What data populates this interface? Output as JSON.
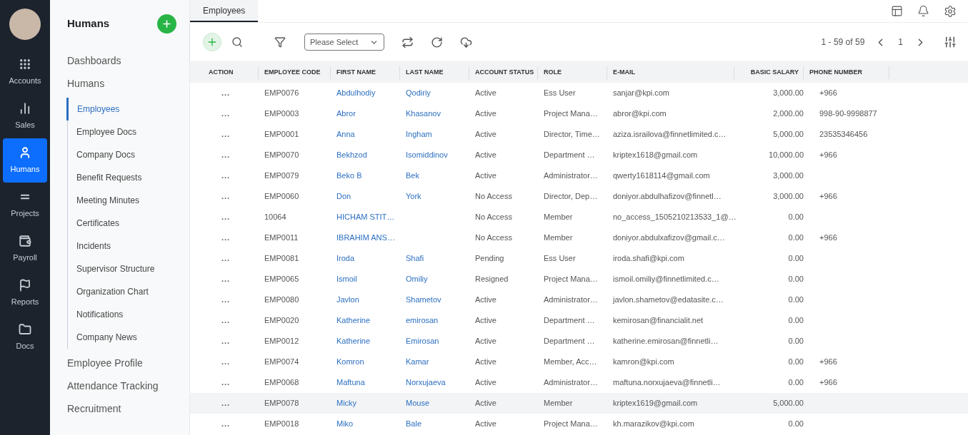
{
  "rail": {
    "items": [
      {
        "label": "Accounts",
        "selected": false
      },
      {
        "label": "Sales",
        "selected": false
      },
      {
        "label": "Humans",
        "selected": true
      },
      {
        "label": "Projects",
        "selected": false
      },
      {
        "label": "Payroll",
        "selected": false
      },
      {
        "label": "Reports",
        "selected": false
      },
      {
        "label": "Docs",
        "selected": false
      }
    ]
  },
  "nav": {
    "title": "Humans",
    "sections": [
      {
        "label": "Dashboards"
      },
      {
        "label": "Humans",
        "children": [
          {
            "label": "Employees",
            "selected": true
          },
          {
            "label": "Employee Docs",
            "selected": false
          },
          {
            "label": "Company Docs",
            "selected": false
          },
          {
            "label": "Benefit Requests",
            "selected": false
          },
          {
            "label": "Meeting Minutes",
            "selected": false
          },
          {
            "label": "Certificates",
            "selected": false
          },
          {
            "label": "Incidents",
            "selected": false
          },
          {
            "label": "Supervisor Structure",
            "selected": false
          },
          {
            "label": "Organization Chart",
            "selected": false
          },
          {
            "label": "Notifications",
            "selected": false
          },
          {
            "label": "Company News",
            "selected": false
          }
        ]
      },
      {
        "label": "Employee Profile"
      },
      {
        "label": "Attendance Tracking"
      },
      {
        "label": "Recruitment"
      }
    ]
  },
  "tabs": [
    {
      "label": "Employees",
      "selected": true
    }
  ],
  "toolbar": {
    "select": {
      "placeholder": "Please Select"
    },
    "pagination": {
      "range": "1 - 59 of 59",
      "page": "1"
    }
  },
  "table": {
    "columns": [
      "ACTION",
      "EMPLOYEE CODE",
      "FIRST NAME",
      "LAST NAME",
      "ACCOUNT STATUS",
      "ROLE",
      "E-MAIL",
      "BASIC SALARY",
      "PHONE NUMBER"
    ],
    "rows": [
      {
        "action": "...",
        "code": "EMP0076",
        "first": "Abdulhodiy",
        "last": "Qodiriy",
        "status": "Active",
        "role": "Ess User",
        "email": "sanjar@kpi.com",
        "salary": "3,000.00",
        "phone": "+966",
        "highlighted": false
      },
      {
        "action": "...",
        "code": "EMP0003",
        "first": "Abror",
        "last": "Khasanov",
        "status": "Active",
        "role": "Project Mana…",
        "email": "abror@kpi.com",
        "salary": "2,000.00",
        "phone": "998-90-9998877",
        "highlighted": false
      },
      {
        "action": "...",
        "code": "EMP0001",
        "first": "Anna",
        "last": "Ingham",
        "status": "Active",
        "role": "Director, Time…",
        "email": "aziza.israilova@finnetlimited.c…",
        "salary": "5,000.00",
        "phone": "23535346456",
        "highlighted": false
      },
      {
        "action": "...",
        "code": "EMP0070",
        "first": "Bekhzod",
        "last": "Isomiddinov",
        "status": "Active",
        "role": "Department …",
        "email": "kriptex1618@gmail.com",
        "salary": "10,000.00",
        "phone": "+966",
        "highlighted": false
      },
      {
        "action": "...",
        "code": "EMP0079",
        "first": "Beko B",
        "last": "Bek",
        "status": "Active",
        "role": "Administrator…",
        "email": "qwerty1618114@gmail.com",
        "salary": "3,000.00",
        "phone": "",
        "highlighted": false
      },
      {
        "action": "...",
        "code": "EMP0060",
        "first": "Don",
        "last": "York",
        "status": "No Access",
        "role": "Director, Dep…",
        "email": "doniyor.abdulhafizov@finnetl…",
        "salary": "3,000.00",
        "phone": "+966",
        "highlighted": false
      },
      {
        "action": "...",
        "code": "10064",
        "first": "HICHAM STIT…",
        "last": "",
        "status": "No Access",
        "role": "Member",
        "email": "no_access_1505210213533_1@…",
        "salary": "0.00",
        "phone": "",
        "highlighted": false
      },
      {
        "action": "...",
        "code": "EMP0011",
        "first": "IBRAHIM ANS…",
        "last": "",
        "status": "No Access",
        "role": "Member",
        "email": "doniyor.abdulxafizov@gmail.c…",
        "salary": "0.00",
        "phone": "+966",
        "highlighted": false
      },
      {
        "action": "...",
        "code": "EMP0081",
        "first": "Iroda",
        "last": "Shafi",
        "status": "Pending",
        "role": "Ess User",
        "email": "iroda.shafi@kpi.com",
        "salary": "0.00",
        "phone": "",
        "highlighted": false
      },
      {
        "action": "...",
        "code": "EMP0065",
        "first": "Ismoil",
        "last": "Omiliy",
        "status": "Resigned",
        "role": "Project Mana…",
        "email": "ismoil.omiliy@finnetlimited.c…",
        "salary": "0.00",
        "phone": "",
        "highlighted": false
      },
      {
        "action": "...",
        "code": "EMP0080",
        "first": "Javlon",
        "last": "Shametov",
        "status": "Active",
        "role": "Administrator…",
        "email": "javlon.shametov@edatasite.c…",
        "salary": "0.00",
        "phone": "",
        "highlighted": false
      },
      {
        "action": "...",
        "code": "EMP0020",
        "first": "Katherine",
        "last": "emirosan",
        "status": "Active",
        "role": "Department …",
        "email": "kemirosan@financialit.net",
        "salary": "0.00",
        "phone": "",
        "highlighted": false
      },
      {
        "action": "...",
        "code": "EMP0012",
        "first": "Katherine",
        "last": "Emirosan",
        "status": "Active",
        "role": "Department …",
        "email": "katherine.emirosan@finnetli…",
        "salary": "0.00",
        "phone": "",
        "highlighted": false
      },
      {
        "action": "...",
        "code": "EMP0074",
        "first": "Komron",
        "last": "Kamar",
        "status": "Active",
        "role": "Member, Acc…",
        "email": "kamron@kpi.com",
        "salary": "0.00",
        "phone": "+966",
        "highlighted": false
      },
      {
        "action": "...",
        "code": "EMP0068",
        "first": "Maftuna",
        "last": "Norxujaeva",
        "status": "Active",
        "role": "Administrator…",
        "email": "maftuna.norxujaeva@finnetli…",
        "salary": "0.00",
        "phone": "+966",
        "highlighted": false
      },
      {
        "action": "...",
        "code": "EMP0078",
        "first": "Micky",
        "last": "Mouse",
        "status": "Active",
        "role": "Member",
        "email": "kriptex1619@gmail.com",
        "salary": "5,000.00",
        "phone": "",
        "highlighted": true
      },
      {
        "action": "...",
        "code": "EMP0018",
        "first": "Miko",
        "last": "Bale",
        "status": "Active",
        "role": "Project Mana…",
        "email": "kh.marazikov@kpi.com",
        "salary": "0.00",
        "phone": "",
        "highlighted": false
      }
    ]
  }
}
